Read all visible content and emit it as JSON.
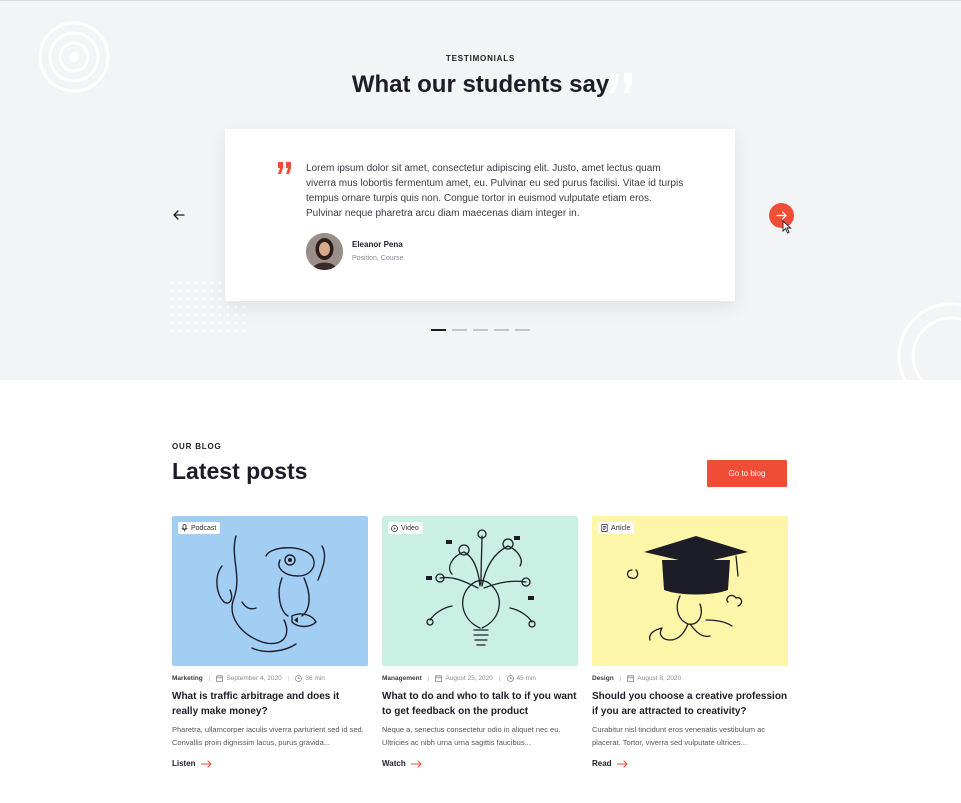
{
  "testimonials": {
    "eyebrow": "TESTIMONIALS",
    "title": "What our students say",
    "quote": "Lorem ipsum dolor sit amet, consectetur adipiscing elit. Justo, amet lectus quam viverra mus lobortis fermentum amet, eu. Pulvinar eu sed purus facilisi. Vitae id turpis tempus ornare turpis quis non. Congue tortor in euismod vulputate etiam eros. Pulvinar neque pharetra arcu diam maecenas diam integer in.",
    "author_name": "Eleanor Pena",
    "author_position": "Position, Course",
    "slides_total": 5,
    "active_slide": 1
  },
  "blog": {
    "eyebrow": "OUR BLOG",
    "title": "Latest posts",
    "go_button": "Go to blog",
    "posts": [
      {
        "badge": "Podcast",
        "badge_icon": "microphone-icon",
        "category": "Marketing",
        "date": "September 4, 2020",
        "duration": "36 min",
        "title": "What is traffic arbitrage and does it really make money?",
        "excerpt": "Pharetra, ullamcorper iaculis viverra parturient sed id sed. Convallis proin dignissim lacus, purus gravida...",
        "link": "Listen",
        "bg_color": "#a3cef4"
      },
      {
        "badge": "Video",
        "badge_icon": "play-icon",
        "category": "Management",
        "date": "August 25, 2020",
        "duration": "45 min",
        "title": "What to do and who to talk to if you want to get feedback on the product",
        "excerpt": "Neque a, senectus consectetur odio in aliquet nec eu. Ultricies ac nibh urna urna sagittis faucibus...",
        "link": "Watch",
        "bg_color": "#c9f0e2"
      },
      {
        "badge": "Article",
        "badge_icon": "document-icon",
        "category": "Design",
        "date": "August 8, 2020",
        "duration": "",
        "title": "Should you choose a creative profession if you are attracted to creativity?",
        "excerpt": "Curabitur nisl tincidunt eros venenatis vestibulum ac placerat. Tortor, viverra sed vulputate ultrices...",
        "link": "Read",
        "bg_color": "#fdf5a8"
      }
    ]
  },
  "colors": {
    "accent": "#f04d37",
    "section_bg": "#f3f4f6",
    "text": "#1d1d27"
  }
}
